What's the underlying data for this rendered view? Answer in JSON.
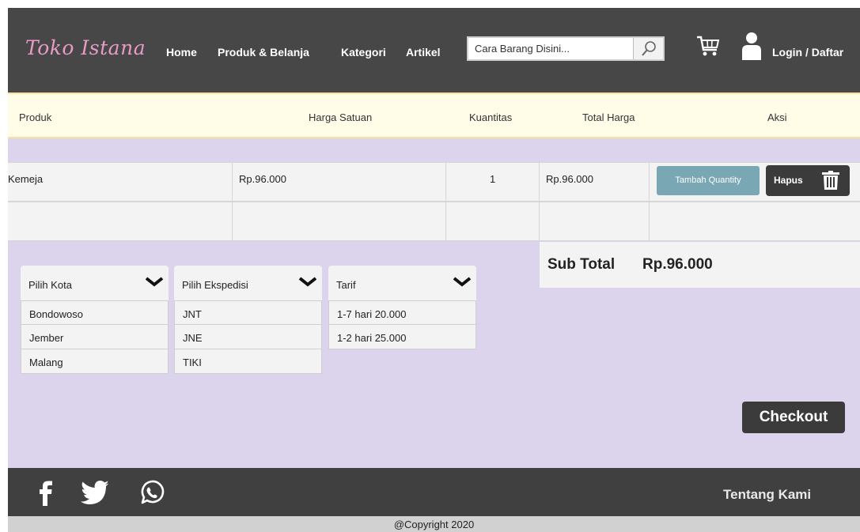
{
  "header": {
    "brand": "Toko Istana",
    "nav": [
      "Home",
      "Produk & Belanja",
      "Kategori",
      "Artikel"
    ],
    "search_placeholder": "Cara Barang Disini...",
    "login_label": "Login / Daftar"
  },
  "table": {
    "columns": [
      "Produk",
      "Harga Satuan",
      "Kuantitas",
      "Total Harga",
      "Aksi"
    ],
    "rows": [
      {
        "produk": "Kemeja",
        "harga": "Rp.96.000",
        "kuantitas": "1",
        "total": "Rp.96.000"
      }
    ],
    "actions": {
      "tambah": "Tambah Quantity",
      "hapus": "Hapus"
    }
  },
  "subtotal": {
    "label": "Sub Total",
    "value": "Rp.96.000"
  },
  "dropdowns": [
    {
      "label": "Pilih Kota",
      "options": [
        "Bondowoso",
        "Jember",
        "Malang"
      ]
    },
    {
      "label": "Pilih Ekspedisi",
      "options": [
        "JNT",
        "JNE",
        "TIKI"
      ]
    },
    {
      "label": "Tarif",
      "options": [
        "1-7 hari 20.000",
        "1-2 hari 25.000"
      ]
    }
  ],
  "checkout_label": "Checkout",
  "footer": {
    "tentang": "Tentang Kami",
    "copyright": "@Copyright 2020",
    "social_icons": [
      "facebook-icon",
      "twitter-icon",
      "whatsapp-icon"
    ]
  },
  "colors": {
    "header_bg": "#474747",
    "brand": "#e79bc6",
    "main_bg": "#dcd4ec",
    "tambah_btn": "#79a7b3",
    "dark_btn": "#3b3b3b"
  }
}
